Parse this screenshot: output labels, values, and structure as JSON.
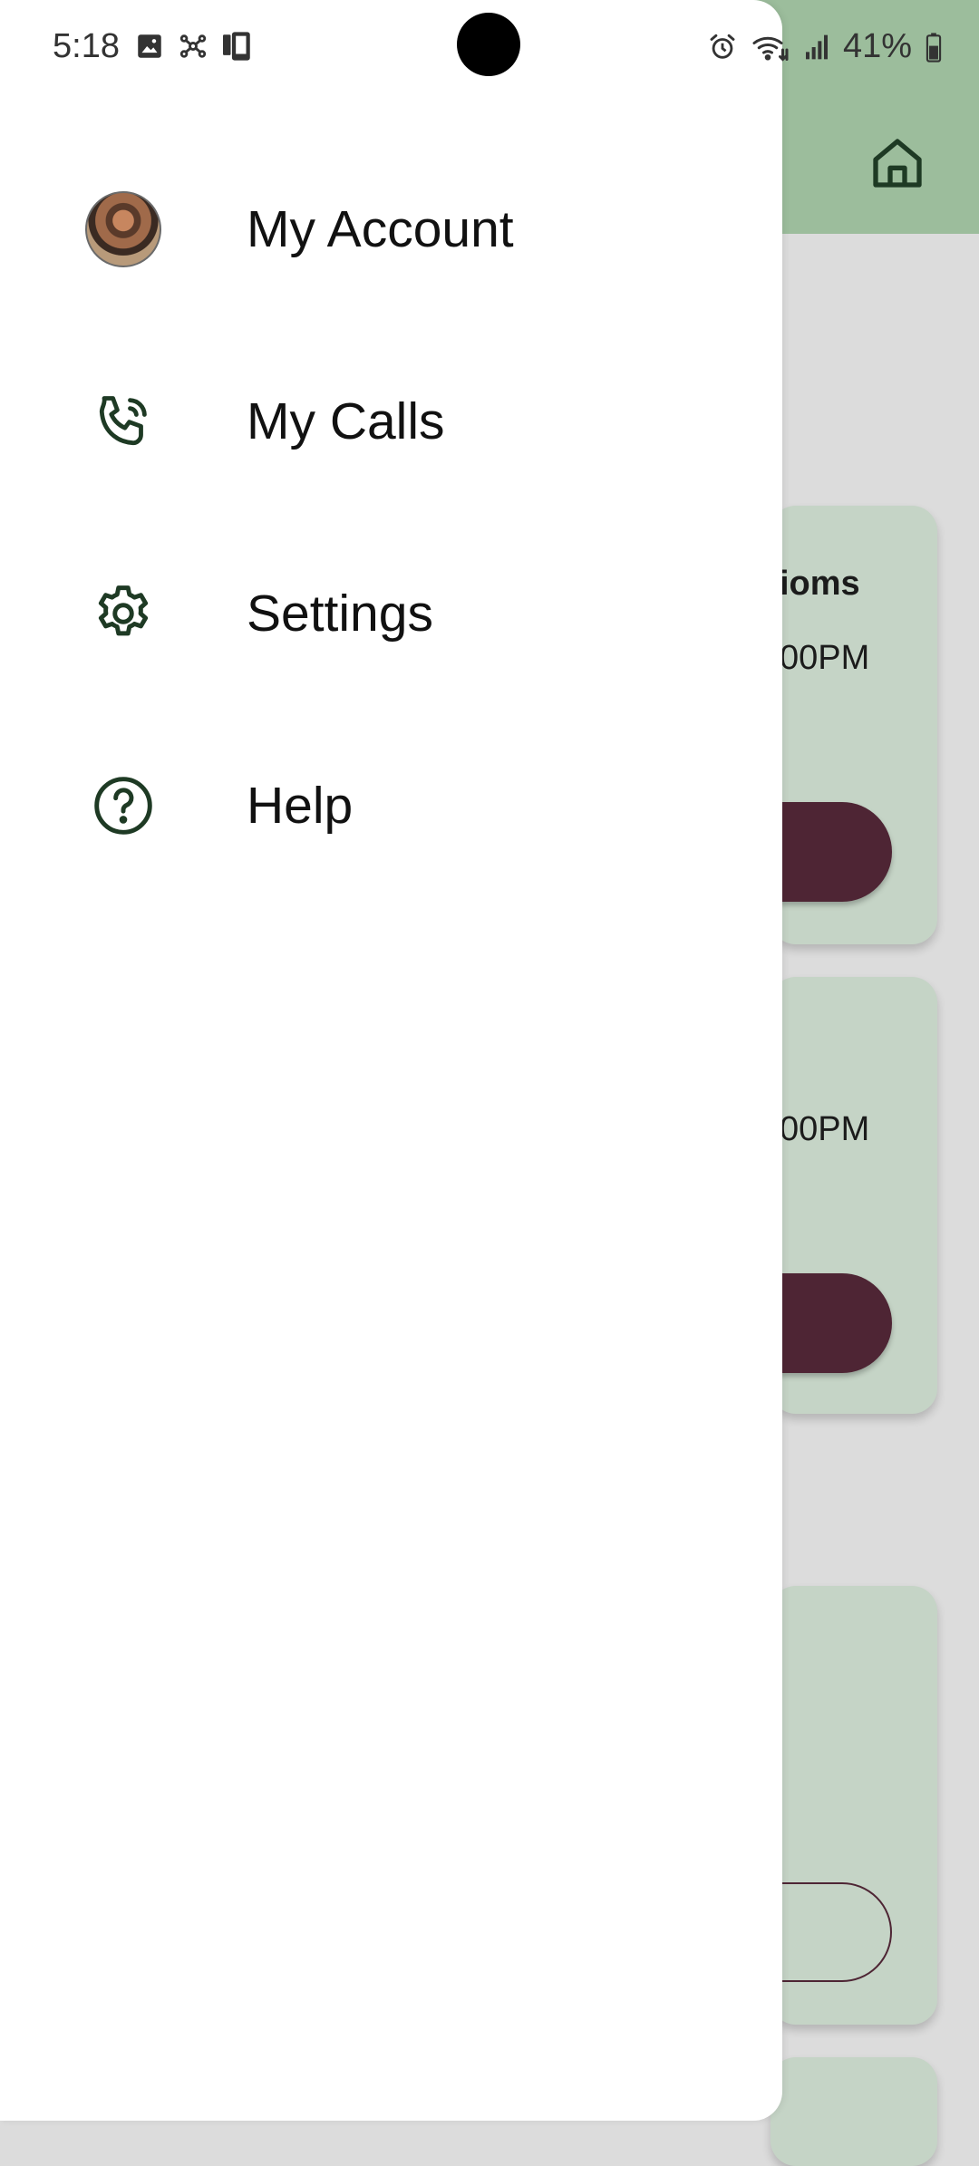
{
  "status_bar": {
    "time": "5:18",
    "battery": "41%",
    "left_icons": [
      "image-icon",
      "network-icon",
      "device-icon"
    ],
    "right_icons": [
      "alarm-icon",
      "wifi-icon",
      "signal-icon",
      "battery-icon"
    ]
  },
  "app_header": {
    "home_icon": "home-icon",
    "color": "#9cbd9c"
  },
  "cards": [
    {
      "title_fragment": "ioms",
      "time_fragment": "00PM"
    },
    {
      "title_fragment": "",
      "time_fragment": "00PM"
    }
  ],
  "drawer": {
    "items": [
      {
        "label": "My Account",
        "icon": "avatar"
      },
      {
        "label": "My Calls",
        "icon": "phone-icon"
      },
      {
        "label": "Settings",
        "icon": "gear-icon"
      },
      {
        "label": "Help",
        "icon": "help-icon"
      }
    ]
  },
  "colors": {
    "icon": "#1e3a24",
    "button": "#4e2534",
    "card": "#c5d4c6"
  }
}
